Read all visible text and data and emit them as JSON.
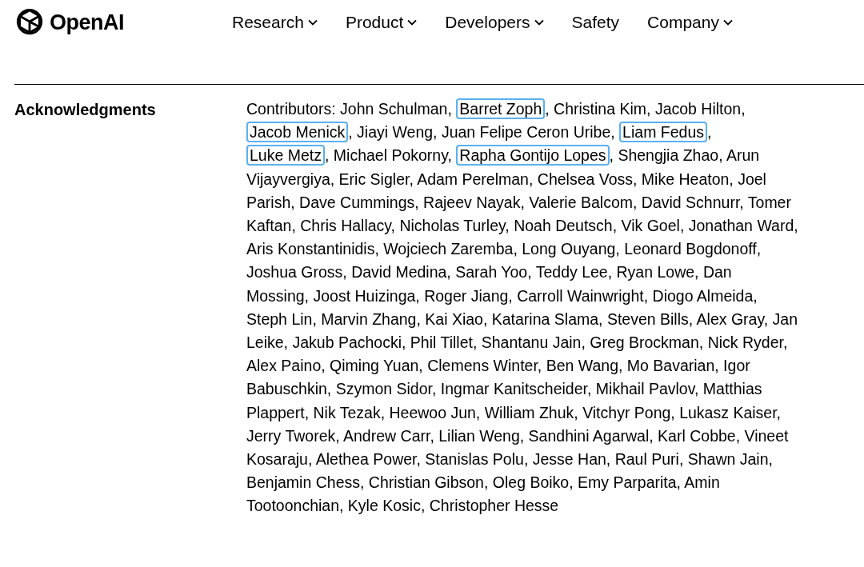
{
  "header": {
    "logo_text": "OpenAI",
    "nav": [
      {
        "label": "Research",
        "has_menu": true
      },
      {
        "label": "Product",
        "has_menu": true
      },
      {
        "label": "Developers",
        "has_menu": true
      },
      {
        "label": "Safety",
        "has_menu": false
      },
      {
        "label": "Company",
        "has_menu": true
      }
    ]
  },
  "section": {
    "heading": "Acknowledgments",
    "segments": [
      {
        "text": "Contributors: John Schulman, ",
        "highlighted": false
      },
      {
        "text": "Barret Zoph",
        "highlighted": true
      },
      {
        "text": ", Christina Kim, Jacob Hilton, ",
        "highlighted": false
      },
      {
        "text": "Jacob Menick",
        "highlighted": true
      },
      {
        "text": ", Jiayi Weng, Juan Felipe Ceron Uribe, ",
        "highlighted": false
      },
      {
        "text": "Liam Fedus",
        "highlighted": true
      },
      {
        "text": ", ",
        "highlighted": false
      },
      {
        "text": "Luke Metz",
        "highlighted": true
      },
      {
        "text": ", Michael Pokorny, ",
        "highlighted": false
      },
      {
        "text": "Rapha Gontijo Lopes",
        "highlighted": true
      },
      {
        "text": ", Shengjia Zhao, Arun Vijayvergiya, Eric Sigler, Adam Perelman, Chelsea Voss, Mike Heaton, Joel Parish, Dave Cummings, Rajeev Nayak, Valerie Balcom, David Schnurr, Tomer Kaftan, Chris Hallacy, Nicholas Turley, Noah Deutsch, Vik Goel, Jonathan Ward, Aris Konstantinidis, Wojciech Zaremba, Long Ouyang, Leonard Bogdonoff, Joshua Gross, David Medina, Sarah Yoo, Teddy Lee, Ryan Lowe, Dan Mossing, Joost Huizinga, Roger Jiang, Carroll Wainwright, Diogo Almeida, Steph Lin, Marvin Zhang, Kai Xiao, Katarina Slama, Steven Bills, Alex Gray, Jan Leike, Jakub Pachocki, Phil Tillet, Shantanu Jain, Greg Brockman, Nick Ryder, Alex Paino, Qiming Yuan, Clemens Winter, Ben Wang, Mo Bavarian, Igor Babuschkin, Szymon Sidor, Ingmar Kanitscheider, Mikhail Pavlov, Matthias Plappert, Nik Tezak, Heewoo Jun, William Zhuk, Vitchyr Pong, Lukasz Kaiser, Jerry Tworek, Andrew Carr, Lilian Weng, Sandhini Agarwal, Karl Cobbe, Vineet Kosaraju, Alethea Power, Stanislas Polu, Jesse Han, Raul Puri, Shawn Jain, Benjamin Chess, Christian Gibson, Oleg Boiko, Emy Parparita, Amin Tootoonchian, Kyle Kosic, Christopher Hesse",
        "highlighted": false
      }
    ]
  }
}
